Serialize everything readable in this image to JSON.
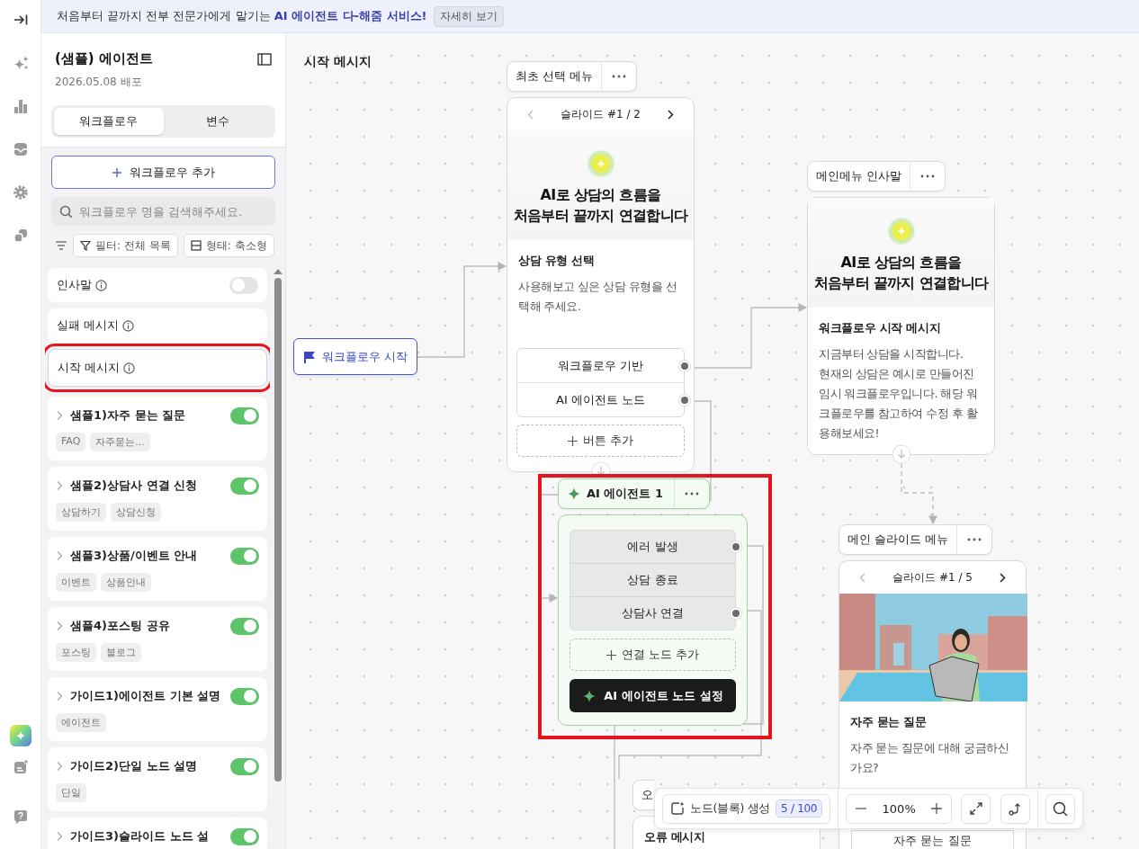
{
  "banner": {
    "text": "처음부터 끝까지 전부 전문가에게 맡기는 **AI 에이전트 다-해줌 서비스!**",
    "button": "자세히 보기"
  },
  "sidebar": {
    "title": "(샘플) 에이전트",
    "subtitle": "2026.05.08 배포",
    "tabs": [
      {
        "label": "워크플로우",
        "selected": true
      },
      {
        "label": "변수",
        "selected": false
      }
    ],
    "add_button": "워크플로우 추가",
    "search": {
      "placeholder": "워크플로우 명을 검색해주세요."
    },
    "filters": [
      {
        "kind": "filter",
        "label": "필터: 전체 목록"
      },
      {
        "kind": "layout",
        "label": "형태: 축소형"
      }
    ],
    "fixed_items": [
      {
        "kind": "toggle",
        "label": "인사말",
        "on": false,
        "selected": false,
        "highlighted": false
      },
      {
        "kind": "plain",
        "label": "실패 메시지",
        "selected": false,
        "highlighted": false
      },
      {
        "kind": "plain",
        "label": "시작 메시지",
        "selected": true,
        "highlighted": true
      }
    ],
    "workflows": [
      {
        "title": "샘플1)자주 묻는 질문",
        "on": true,
        "tags": [
          "FAQ",
          "자주묻는..."
        ]
      },
      {
        "title": "샘플2)상담사 연결 신청",
        "on": true,
        "tags": [
          "상담하기",
          "상담신청"
        ]
      },
      {
        "title": "샘플3)상품/이벤트 안내",
        "on": true,
        "tags": [
          "이벤트",
          "상품안내"
        ]
      },
      {
        "title": "샘플4)포스팅 공유",
        "on": true,
        "tags": [
          "포스팅",
          "블로그"
        ]
      },
      {
        "title": "가이드1)에이전트 기본 설명",
        "on": true,
        "tags": [
          "에이전트"
        ]
      },
      {
        "title": "가이드2)단일 노드 설명",
        "on": true,
        "tags": [
          "단일"
        ]
      },
      {
        "title": "가이드3)슬라이드 노드 설",
        "on": true
      }
    ]
  },
  "canvas": {
    "title": "시작 메시지",
    "start_node": {
      "label": "워크플로우 시작"
    },
    "nodes": [
      {
        "kind": "slide",
        "name": "최초 선택 메뉴",
        "slide_label": "슬라이드 #1 / 2",
        "hero_title": "AI로 상담의 흐름을\n처음부터 끝까지 연결합니다",
        "heading": "상담 유형 선택",
        "body": "사용해보고 싶은 상담 유형을 선택해 주세요.",
        "buttons": [
          {
            "label": "워크플로우 기반",
            "connected": true
          },
          {
            "label": "AI 에이전트 노드",
            "connected": true
          }
        ],
        "add_button": "버튼 추가"
      },
      {
        "kind": "message",
        "name": "메인메뉴 인사말",
        "hero_title": "AI로 상담의 흐름을\n처음부터 끝까지 연결합니다",
        "heading": "워크플로우 시작 메시지",
        "body": "지금부터 상담을 시작합니다.\n현재의 상담은 예시로 만들어진 임시 워크플로우입니다. 해당 워크플로우를 참고하여 수정 후 활용해보세요!"
      },
      {
        "kind": "agent",
        "name": "AI 에이전트 1",
        "highlighted": true,
        "outcomes": [
          {
            "label": "에러 발생",
            "connected": true
          },
          {
            "label": "상담 종료",
            "connected": false
          },
          {
            "label": "상담사 연결",
            "connected": true
          }
        ],
        "add_button": "연결 노드 추가",
        "settings_button": "AI 에이전트 노드 설정"
      },
      {
        "kind": "message_stub",
        "name": "오",
        "heading": "오류 메시지"
      },
      {
        "kind": "image_slide",
        "name": "메인 슬라이드 메뉴",
        "slide_label": "슬라이드 #1 / 5",
        "heading": "자주 묻는 질문",
        "body": "자주 묻는 질문에 대해 궁금하신가요?",
        "footer_button": "자주 묻는 질문"
      }
    ]
  },
  "toolbar": {
    "create_button": "노드(블록) 생성",
    "count": "5 / 100",
    "zoom": "100%"
  }
}
